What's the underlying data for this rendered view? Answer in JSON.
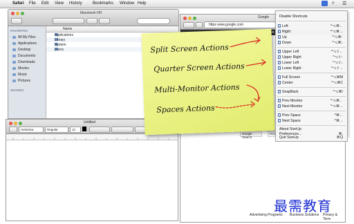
{
  "menubar": {
    "apple": "",
    "app": "Safari",
    "items": [
      "File",
      "Edit",
      "View",
      "History",
      "Bookmarks",
      "Window",
      "Help"
    ]
  },
  "finder": {
    "title": "Macintosh HD",
    "favorites_header": "FAVORITES",
    "favorites": [
      "All My Files",
      "Applications",
      "Desktop",
      "Documents",
      "Downloads",
      "Movies",
      "Music",
      "Pictures"
    ],
    "shared_header": "SHARED",
    "column_name": "Name",
    "files": [
      "Applications",
      "Library",
      "System",
      "Users"
    ]
  },
  "safari": {
    "tab_title": "Google",
    "address": "https  www.google.com",
    "google_search": "Google Search",
    "im_feeling_lucky": "I'm F",
    "footer": [
      "Advertising Programs",
      "Business Solutions",
      "Privacy & Term"
    ]
  },
  "document": {
    "title": "Untitled",
    "style": "Helvetica",
    "weight": "Regular",
    "size": "12"
  },
  "note": {
    "lines": [
      "Split Screen Actions",
      "Quarter Screen Actions",
      "Multi-Monitor Actions",
      "Spaces Actions"
    ]
  },
  "sizeup_menu": {
    "header": "Disable Shortcuts",
    "groups": [
      [
        {
          "label": "Left",
          "shortcut": "^⌥⌘←"
        },
        {
          "label": "Right",
          "shortcut": "^⌥⌘→"
        },
        {
          "label": "Up",
          "shortcut": "^⌥⌘↑"
        },
        {
          "label": "Down",
          "shortcut": "^⌥⌘↓"
        }
      ],
      [
        {
          "label": "Upper Left",
          "shortcut": "^⌥⇧←"
        },
        {
          "label": "Upper Right",
          "shortcut": "^⌥⇧↑"
        },
        {
          "label": "Lower Left",
          "shortcut": "^⌥⇧↓"
        },
        {
          "label": "Lower Right",
          "shortcut": "^⌥⇧→"
        }
      ],
      [
        {
          "label": "Full Screen",
          "shortcut": "^⌥⌘M"
        },
        {
          "label": "Center",
          "shortcut": "^⌥⌘C"
        }
      ],
      [
        {
          "label": "SnapBack",
          "shortcut": "^⌥⌘/"
        }
      ],
      [
        {
          "label": "Prev Monitor",
          "shortcut": "^⌥⌘←"
        },
        {
          "label": "Next Monitor",
          "shortcut": "^⌥⌘→"
        }
      ],
      [
        {
          "label": "Prev Space",
          "shortcut": "^⌘←"
        },
        {
          "label": "Next Space",
          "shortcut": "^⌘→"
        }
      ]
    ],
    "footer": [
      {
        "label": "About SizeUp",
        "shortcut": ""
      },
      {
        "label": "Preferences...",
        "shortcut": "⌘,"
      },
      {
        "label": "Quit SizeUp",
        "shortcut": "⌘Q"
      }
    ]
  },
  "watermark": "最需教育"
}
